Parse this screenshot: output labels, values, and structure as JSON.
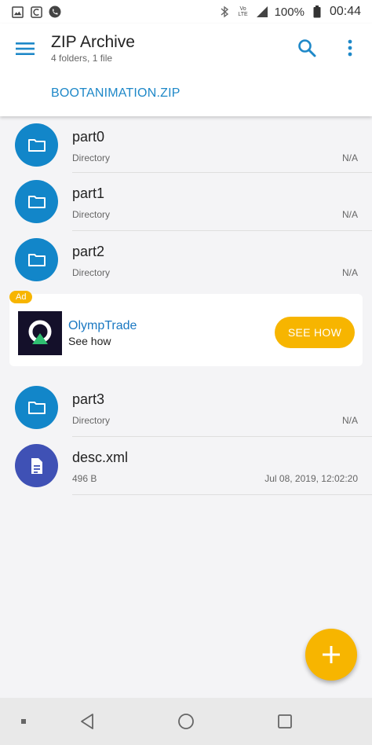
{
  "status_bar": {
    "battery_text": "100%",
    "time": "00:44",
    "volte": "Vo\nLTE"
  },
  "app_bar": {
    "title": "ZIP Archive",
    "subtitle": "4 folders, 1 file",
    "breadcrumb": "BOOTANIMATION.ZIP"
  },
  "items": [
    {
      "name": "part0",
      "meta": "Directory",
      "right": "N/A",
      "icon": "folder-icon"
    },
    {
      "name": "part1",
      "meta": "Directory",
      "right": "N/A",
      "icon": "folder-icon"
    },
    {
      "name": "part2",
      "meta": "Directory",
      "right": "N/A",
      "icon": "folder-icon"
    },
    {
      "name": "part3",
      "meta": "Directory",
      "right": "N/A",
      "icon": "folder-icon"
    },
    {
      "name": "desc.xml",
      "meta": "496 B",
      "right": "Jul 08, 2019, 12:02:20",
      "icon": "document-icon"
    }
  ],
  "ad": {
    "badge": "Ad",
    "title": "OlympTrade",
    "subtitle": "See how",
    "cta": "SEE HOW"
  },
  "colors": {
    "accent": "#1e88c8",
    "folder": "#1286c9",
    "file": "#3f51b5",
    "fab": "#f7b500"
  }
}
